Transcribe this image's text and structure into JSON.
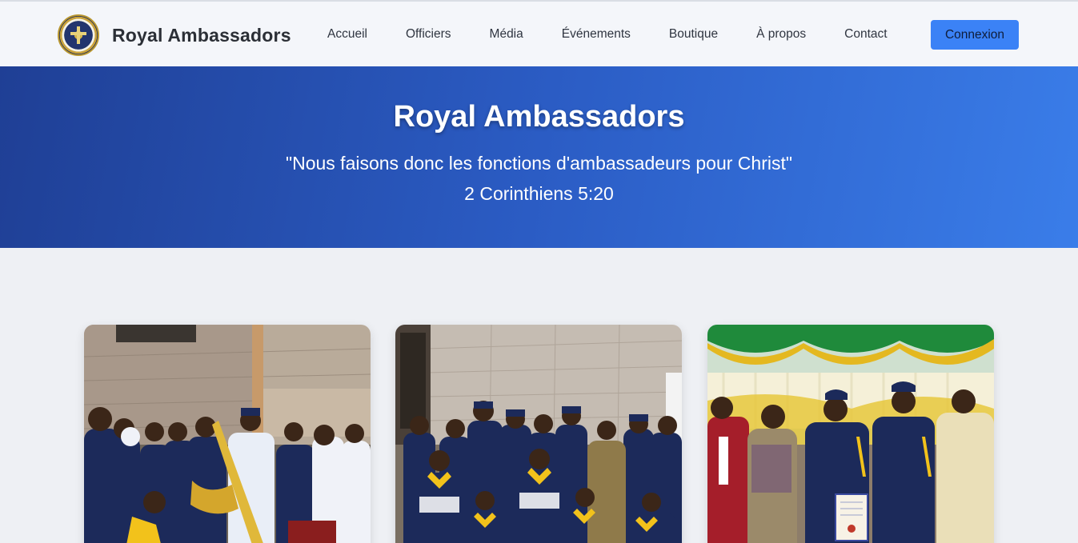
{
  "brand": {
    "name": "Royal Ambassadors",
    "logo_icon": "royal-ambassadors-emblem-icon"
  },
  "nav": {
    "links": [
      "Accueil",
      "Officiers",
      "Média",
      "Événements",
      "Boutique",
      "À propos",
      "Contact"
    ],
    "login_label": "Connexion"
  },
  "hero": {
    "title": "Royal Ambassadors",
    "quote": "\"Nous faisons donc les fonctions d'ambassadeurs pour Christ\"",
    "reference": "2 Corinthiens 5:20"
  },
  "gallery": {
    "photos": [
      "group-photo-band",
      "group-photo-members",
      "award-ceremony-photo"
    ]
  },
  "colors": {
    "accent": "#3b82f6",
    "hero_start": "#1f3f95",
    "hero_end": "#3a7de9",
    "uniform_navy": "#1c2a5a",
    "scarf_yellow": "#f2c21b"
  }
}
